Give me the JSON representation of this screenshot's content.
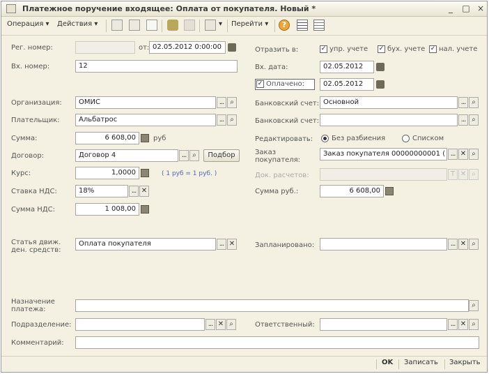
{
  "window": {
    "title": "Платежное поручение входящее: Оплата от покупателя. Новый *",
    "controls": [
      "_",
      "□",
      "×"
    ]
  },
  "toolbar": {
    "operation": "Операция",
    "actions": "Действия",
    "goto": "Перейти",
    "icons": [
      "copy-icon",
      "docs-icon",
      "page-icon",
      "post-icon",
      "structure-icon",
      "send-icon",
      "help-icon",
      "journal-icon",
      "table-icon"
    ]
  },
  "form": {
    "reg_number_label": "Рег. номер:",
    "reg_number_value": "",
    "from_label": "от:",
    "reg_date": "02.05.2012  0:00:00",
    "reflect_label": "Отразить в:",
    "reflect_options": [
      {
        "label": "упр. учете",
        "checked": true
      },
      {
        "label": "бух. учете",
        "checked": true
      },
      {
        "label": "нал. учете",
        "checked": true
      }
    ],
    "in_number_label": "Вх. номер:",
    "in_number_value": "12",
    "in_date_label": "Вх. дата:",
    "in_date_value": "02.05.2012",
    "paid_label": "Оплачено:",
    "paid_checked": true,
    "paid_date": "02.05.2012",
    "org_label": "Организация:",
    "org_value": "ОМИС",
    "bank_account_label": "Банковский счет:",
    "bank_account_value": "Основной",
    "payer_label": "Плательщик:",
    "payer_value": "Альбатрос",
    "payer_bank_label": "Банковский счет:",
    "payer_bank_value": "",
    "sum_label": "Сумма:",
    "sum_value": "6 608,00",
    "sum_currency": "руб",
    "edit_label": "Редактировать:",
    "edit_options": [
      {
        "label": "Без разбиения",
        "selected": true
      },
      {
        "label": "Списком",
        "selected": false
      }
    ],
    "contract_label": "Договор:",
    "contract_value": "Договор 4",
    "pick_button": "Подбор",
    "order_label": "Заказ покупателя:",
    "order_value": "Заказ покупателя 00000000001 (",
    "rate_label": "Курс:",
    "rate_value": "1,0000",
    "rate_note": "( 1 руб = 1 руб. )",
    "settle_doc_label": "Док. расчетов:",
    "settle_doc_value": "",
    "vat_rate_label": "Ставка НДС:",
    "vat_rate_value": "18%",
    "sum_rub_label": "Сумма руб.:",
    "sum_rub_value": "6 608,00",
    "vat_sum_label": "Сумма НДС:",
    "vat_sum_value": "1 008,00",
    "cashflow_label": "Статья движ. ден. средств:",
    "cashflow_value": "Оплата покупателя",
    "planned_label": "Запланировано:",
    "planned_value": "",
    "purpose_label": "Назначение платежа:",
    "purpose_value": "",
    "department_label": "Подразделение:",
    "department_value": "",
    "responsible_label": "Ответственный:",
    "responsible_value": "",
    "comment_label": "Комментарий:",
    "comment_value": ""
  },
  "bottom": {
    "ok": "OK",
    "save": "Записать",
    "close": "Закрыть"
  },
  "colors": {
    "window_bg": "#f4f1e2",
    "link": "#4a6ab0"
  }
}
